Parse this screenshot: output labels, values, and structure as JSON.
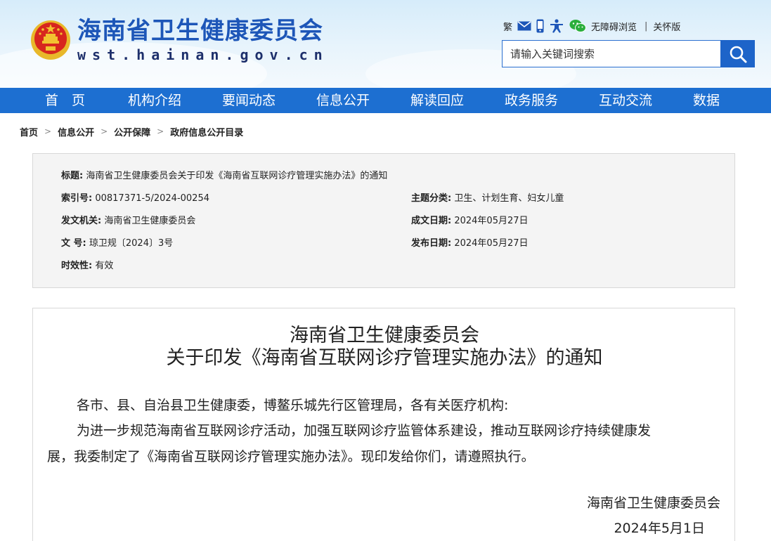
{
  "site": {
    "title": "海南省卫生健康委员会",
    "domain": "wst.hainan.gov.cn"
  },
  "toolbar": {
    "traditional": "繁",
    "accessible": "无障碍浏览",
    "separator": "|",
    "care_mode": "关怀版"
  },
  "search": {
    "placeholder": "请输入关键词搜索"
  },
  "nav": [
    "首　页",
    "机构介绍",
    "要闻动态",
    "信息公开",
    "解读回应",
    "政务服务",
    "互动交流",
    "数据"
  ],
  "breadcrumb": [
    "首页",
    "信息公开",
    "公开保障",
    "政府信息公开目录"
  ],
  "info": {
    "title_label": "标题:",
    "title_value": "海南省卫生健康委员会关于印发《海南省互联网诊疗管理实施办法》的通知",
    "index_label": "索引号:",
    "index_value": "00817371-5/2024-00254",
    "topic_label": "主题分类:",
    "topic_value": "卫生、计划生育、妇女儿童",
    "issuer_label": "发文机关:",
    "issuer_value": "海南省卫生健康委员会",
    "created_label": "成文日期:",
    "created_value": "2024年05月27日",
    "docno_label": "文 号:",
    "docno_value": "琼卫规〔2024〕3号",
    "published_label": "发布日期:",
    "published_value": "2024年05月27日",
    "validity_label": "时效性:",
    "validity_value": "有效"
  },
  "doc": {
    "title_line1": "海南省卫生健康委员会",
    "title_line2": "关于印发《海南省互联网诊疗管理实施办法》的通知",
    "salutation": "各市、县、自治县卫生健康委，博鳌乐城先行区管理局，各有关医疗机构:",
    "body_line1": "为进一步规范海南省互联网诊疗活动，加强互联网诊疗监管体系建设，推动互联网诊疗持续健康发",
    "body_line2": "展，我委制定了《海南省互联网诊疗管理实施办法》。现印发给你们，请遵照执行。",
    "sign_org": "海南省卫生健康委员会",
    "sign_date": "2024年5月1日"
  },
  "colors": {
    "brand_blue": "#1d56b8",
    "nav_blue": "#1d6fd1",
    "search_button": "#1d64c9",
    "emblem_red": "#d7261e",
    "emblem_gold": "#f2c230"
  }
}
